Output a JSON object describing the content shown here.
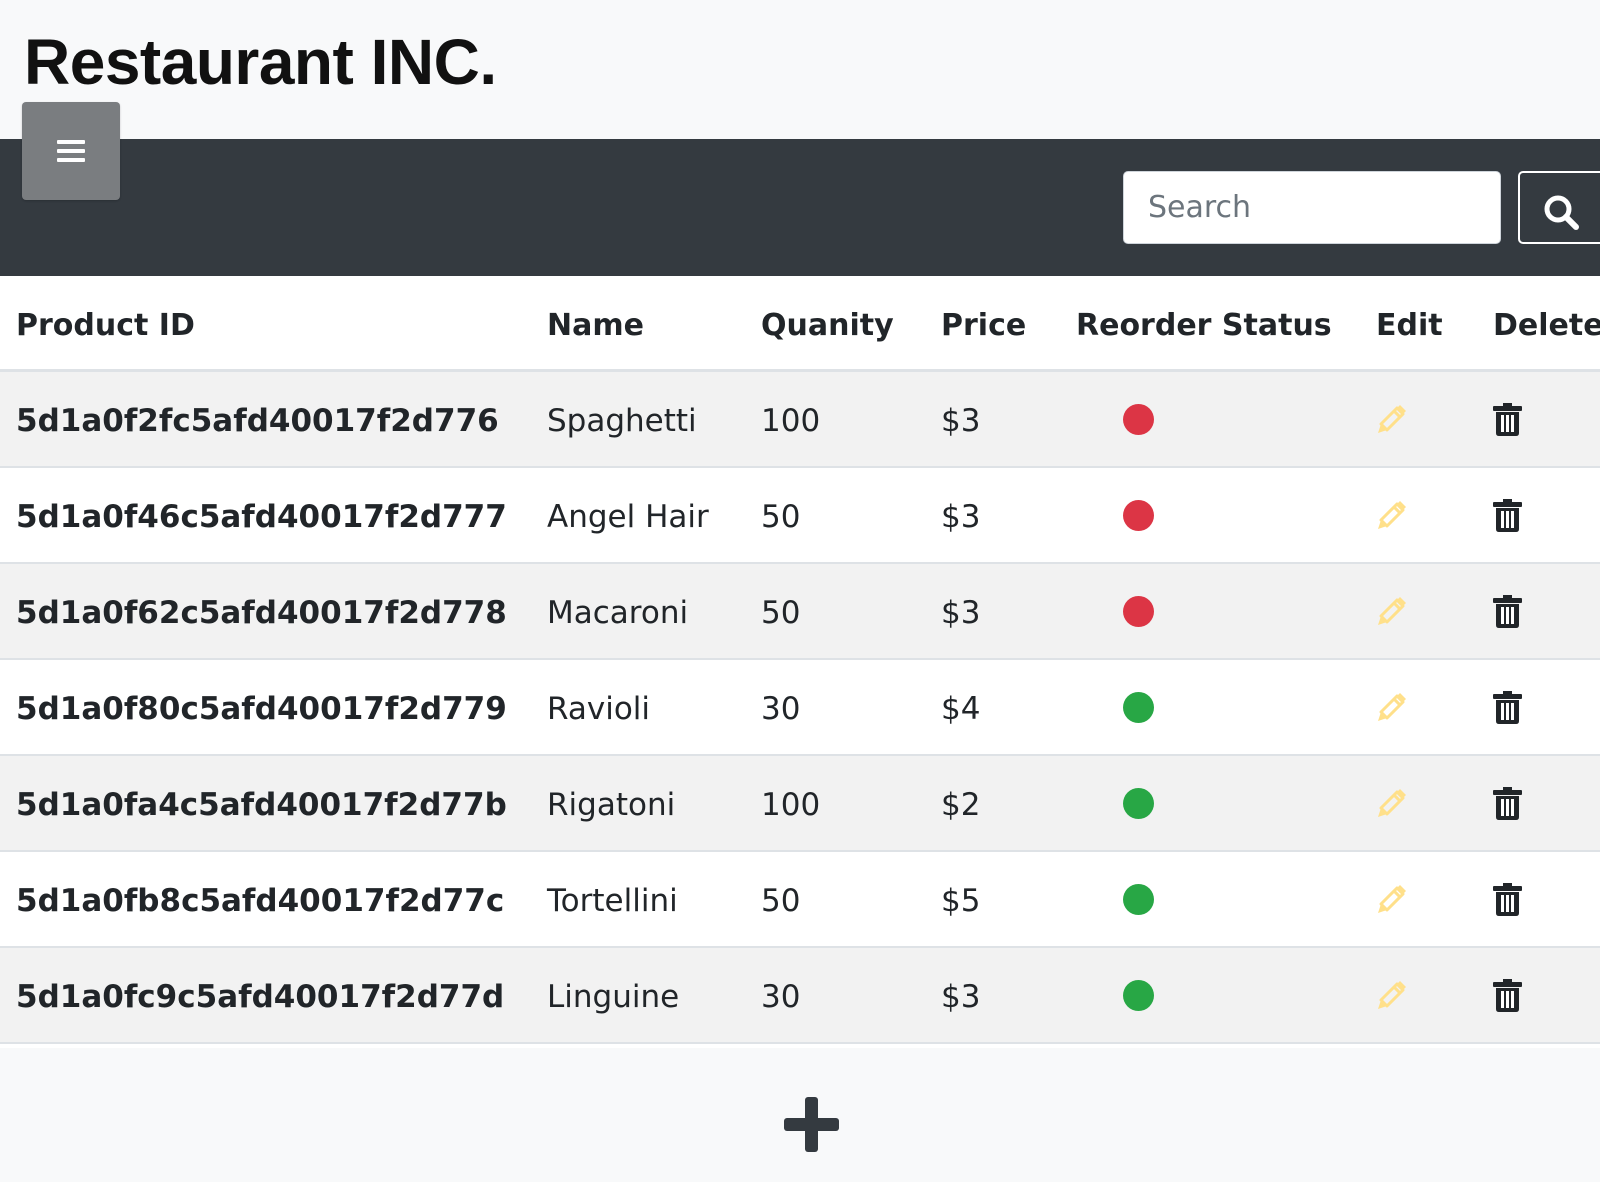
{
  "header": {
    "brand": "Restaurant INC."
  },
  "navbar": {
    "menu_icon": "hamburger-menu-icon",
    "search": {
      "placeholder": "Search",
      "value": ""
    },
    "search_icon": "magnifying-glass-icon"
  },
  "table": {
    "headers": [
      "Product ID",
      "Name",
      "Quanity",
      "Price",
      "Reorder Status",
      "Edit",
      "Delete"
    ],
    "rows": [
      {
        "id": "5d1a0f2fc5afd40017f2d776",
        "name": "Spaghetti",
        "quantity": "100",
        "price": "$3",
        "status": "red"
      },
      {
        "id": "5d1a0f46c5afd40017f2d777",
        "name": "Angel Hair",
        "quantity": "50",
        "price": "$3",
        "status": "red"
      },
      {
        "id": "5d1a0f62c5afd40017f2d778",
        "name": "Macaroni",
        "quantity": "50",
        "price": "$3",
        "status": "red"
      },
      {
        "id": "5d1a0f80c5afd40017f2d779",
        "name": "Ravioli",
        "quantity": "30",
        "price": "$4",
        "status": "green"
      },
      {
        "id": "5d1a0fa4c5afd40017f2d77b",
        "name": "Rigatoni",
        "quantity": "100",
        "price": "$2",
        "status": "green"
      },
      {
        "id": "5d1a0fb8c5afd40017f2d77c",
        "name": "Tortellini",
        "quantity": "50",
        "price": "$5",
        "status": "green"
      },
      {
        "id": "5d1a0fc9c5afd40017f2d77d",
        "name": "Linguine",
        "quantity": "30",
        "price": "$3",
        "status": "green"
      }
    ],
    "edit_icon": "pencil-icon",
    "delete_icon": "trash-icon"
  },
  "footer": {
    "add_icon": "plus-icon"
  },
  "colors": {
    "navbar": "#343a40",
    "status_red": "#dc3545",
    "status_green": "#28a745",
    "edit_icon": "#ffe08a",
    "delete_icon": "#212529",
    "row_stripe": "#f2f2f2"
  }
}
